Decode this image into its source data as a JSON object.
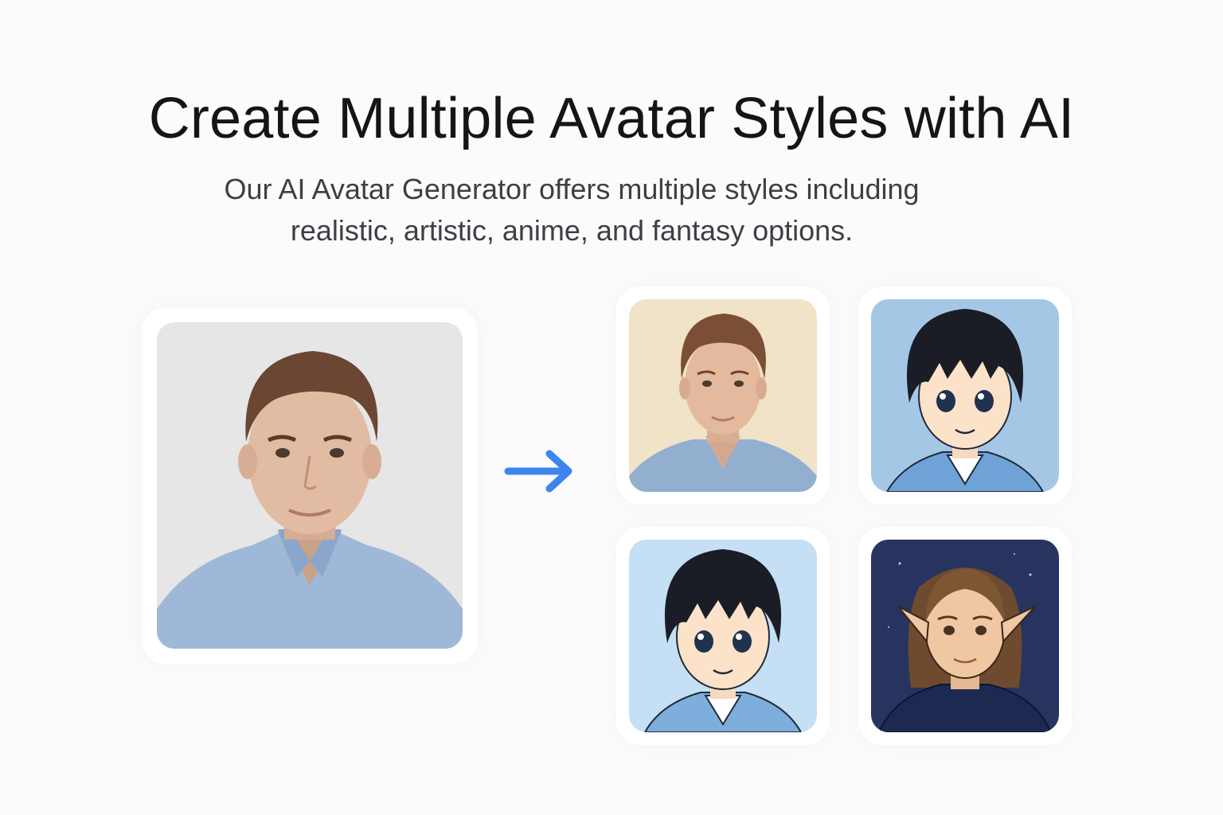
{
  "hero": {
    "title": "Create Multiple Avatar Styles with AI",
    "subtitle_line1": "Our AI Avatar Generator offers multiple styles including",
    "subtitle_line2": "realistic, artistic, anime, and fantasy options."
  },
  "colors": {
    "arrow": "#3d84ef",
    "source_bg": "#e6e6e6",
    "realistic_bg": "#f0e3c8",
    "anime1_bg": "#a4c7e6",
    "anime2_bg": "#c5dff4",
    "fantasy_bg": "#27345f"
  },
  "icons": {
    "transform": "right-arrow-icon"
  }
}
